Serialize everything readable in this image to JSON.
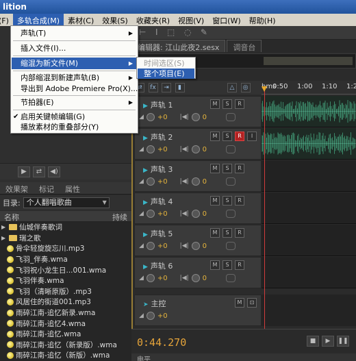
{
  "window": {
    "title": "lition"
  },
  "menubar": [
    {
      "label": "文件(F)"
    },
    {
      "label": "多轨合成(M)"
    },
    {
      "label": "素材(C)"
    },
    {
      "label": "效果(S)"
    },
    {
      "label": "收藏夹(R)"
    },
    {
      "label": "视图(V)"
    },
    {
      "label": "窗口(W)"
    },
    {
      "label": "帮助(H)"
    }
  ],
  "menu": {
    "items": [
      {
        "label": "声轨(T)"
      },
      {
        "label": "插入文件(I)..."
      },
      {
        "label": "缩混为新文件(M)"
      },
      {
        "label": "内部缩混到新建声轨(B)"
      },
      {
        "label": "导出到 Adobe Premiere Pro(X)..."
      },
      {
        "label": "节拍器(E)"
      },
      {
        "label": "启用关键帧编辑(G)"
      },
      {
        "label": "播放素材的重叠部分(Y)"
      }
    ],
    "submenu": [
      {
        "label": "时间选区(S)"
      },
      {
        "label": "整个项目(E)"
      }
    ]
  },
  "left_panel": {
    "tabs": [
      "效果架",
      "标记",
      "属性"
    ],
    "dir_label": "目录:",
    "dir_value": "个人翻唱歌曲",
    "header_name": "名称",
    "header_dur": "持续",
    "files": [
      {
        "name": "仙城伴奏歌词"
      },
      {
        "name": "瑞之歌"
      },
      {
        "name": "骨伞轻旋旋忘川.mp3"
      },
      {
        "name": "飞羽_伴奏.wma"
      },
      {
        "name": "飞羽祝小龙生日...001.wma"
      },
      {
        "name": "飞羽伴奏.wma"
      },
      {
        "name": "飞羽（清晰原版）.mp3"
      },
      {
        "name": "风居住的街道001.mp3"
      },
      {
        "name": "雨碎江南-追忆新录.wma"
      },
      {
        "name": "雨碎江南-追忆4.wma"
      },
      {
        "name": "雨碎江南-追忆.wma"
      },
      {
        "name": "雨碎江南-追忆（新录版）.wma"
      },
      {
        "name": "雨碎江南-追忆（新版）.wma"
      }
    ]
  },
  "editor": {
    "tab": "编辑器: 江山此夜2.sesx",
    "tab2": "调音台",
    "ruler": [
      "hms",
      "0:50",
      "1:00",
      "1:10",
      "1:2"
    ],
    "tracks": [
      {
        "name": "声轨 1",
        "vol": "+0",
        "pan": "0",
        "armed": false
      },
      {
        "name": "声轨 2",
        "vol": "+0",
        "pan": "0",
        "armed": true
      },
      {
        "name": "声轨 3",
        "vol": "+0",
        "pan": "0",
        "armed": false
      },
      {
        "name": "声轨 4",
        "vol": "+0",
        "pan": "0",
        "armed": false
      },
      {
        "name": "声轨 5",
        "vol": "+0",
        "pan": "0",
        "armed": false
      },
      {
        "name": "声轨 6",
        "vol": "+0",
        "pan": "0",
        "armed": false
      }
    ],
    "master": {
      "name": "主控",
      "vol": "+0"
    },
    "time": "0:44.270",
    "bottom_tab": "电平"
  },
  "colors": {
    "accent": "#2d5fb1",
    "time": "#e5a43a",
    "wave": "#3c8a6a"
  }
}
